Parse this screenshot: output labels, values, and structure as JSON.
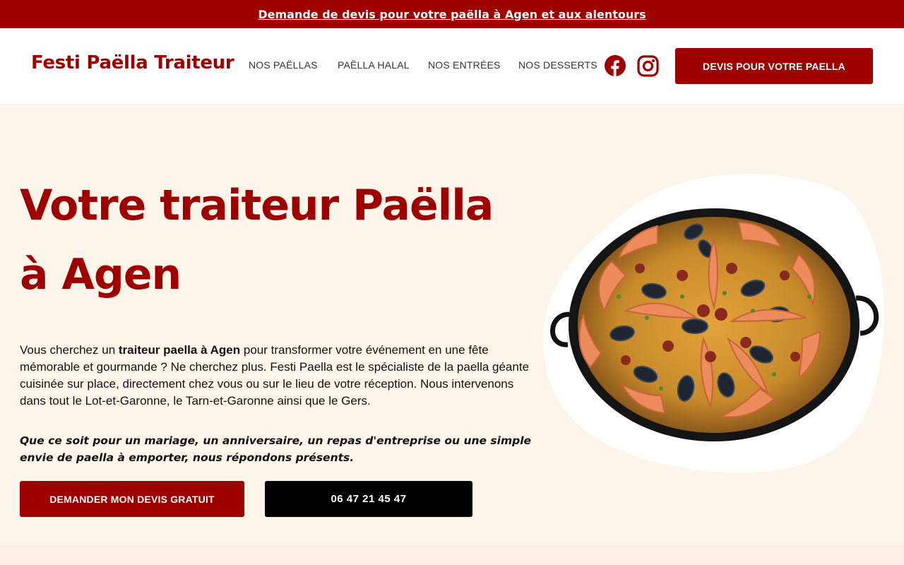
{
  "topbar": {
    "link": "Demande de devis pour votre paëlla à Agen et aux alentours"
  },
  "header": {
    "logo": "Festi Paëlla Traiteur",
    "nav": [
      "NOS PAËLLAS",
      "PAËLLA HALAL",
      "NOS ENTRÉES",
      "NOS DESSERTS"
    ],
    "social": [
      "facebook-icon",
      "instagram-icon"
    ],
    "cta": "DEVIS POUR VOTRE PAELLA"
  },
  "hero": {
    "title_line1": "Votre traiteur Paëlla",
    "title_line2": "à Agen",
    "text_before": "Vous cherchez un ",
    "text_bold": "traiteur paella à Agen",
    "text_after": " pour transformer votre événement en une fête mémorable et gourmande ? Ne cherchez plus. Festi Paella est le spécialiste de la paella géante cuisinée sur place, directement chez vous ou sur le lieu de votre réception. Nous intervenons dans tout le Lot-et-Garonne, le Tarn-et-Garonne ainsi que le Gers.",
    "quote": "Que ce soit pour un mariage, un anniversaire, un repas d'entreprise ou une simple envie de paella à emporter, nous répondons présents.",
    "btn_quote": "DEMANDER MON DEVIS GRATUIT",
    "btn_phone": "06 47 21 45 47"
  },
  "colors": {
    "brand_red": "#9e0000",
    "background": "#fdf5ea",
    "black": "#000000"
  }
}
